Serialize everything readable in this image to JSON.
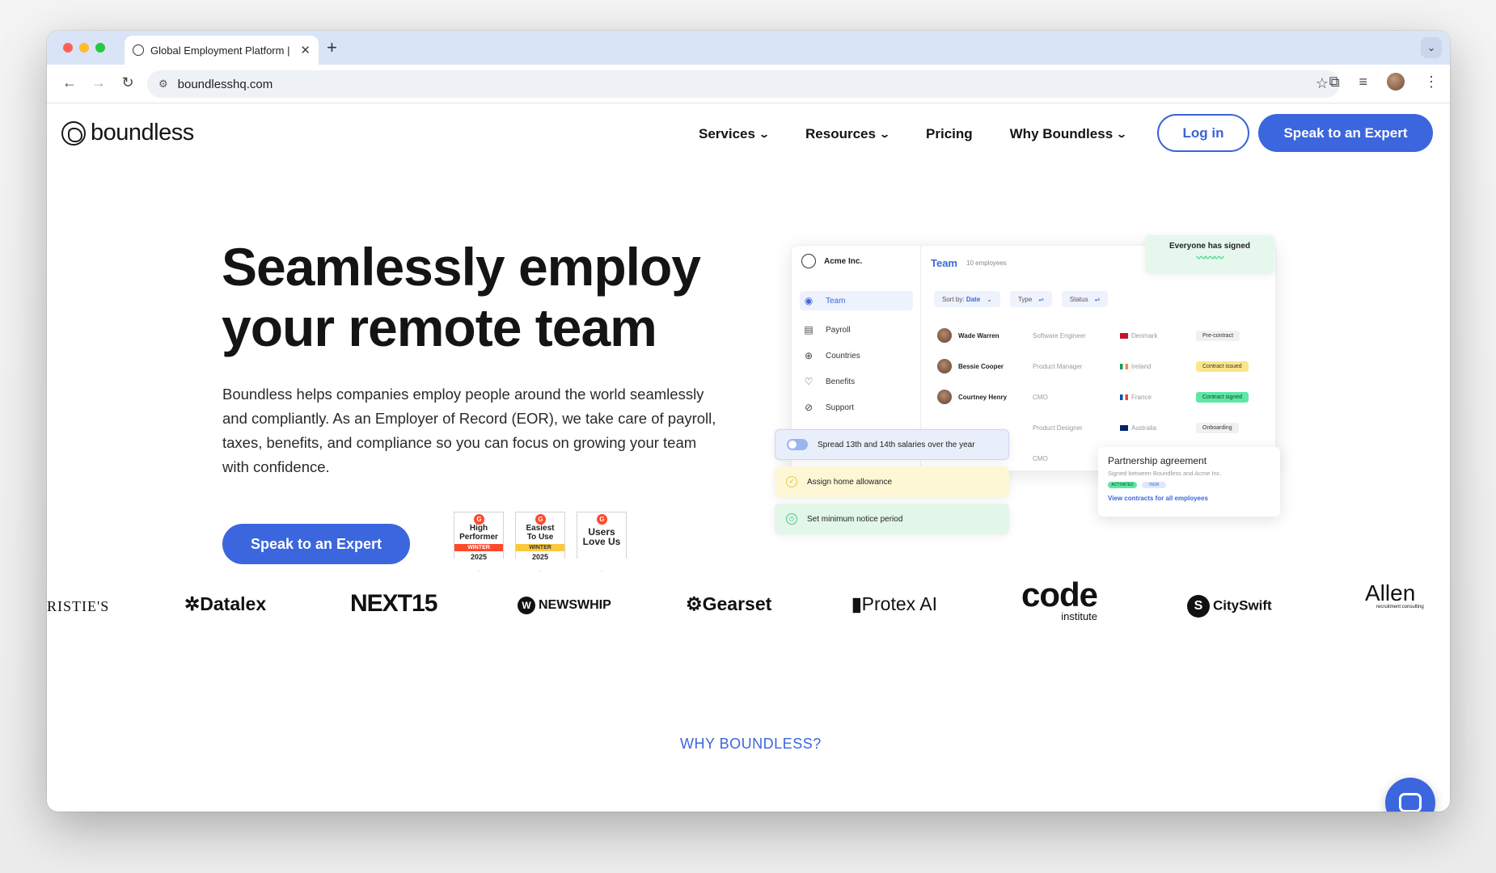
{
  "browser": {
    "tab_title": "Global Employment Platform |",
    "new_tab": "+",
    "url": "boundlesshq.com"
  },
  "site": {
    "logo_text": "boundless",
    "nav": [
      {
        "label": "Services"
      },
      {
        "label": "Resources"
      },
      {
        "label": "Pricing"
      },
      {
        "label": "Why Boundless"
      }
    ],
    "login_label": "Log in",
    "cta_top": "Speak to an Expert"
  },
  "hero": {
    "title": "Seamlessly employ your remote team",
    "description": "Boundless helps companies employ people around the world seamlessly and compliantly. As an Employer of Record (EOR), we take care of payroll, taxes, benefits, and compliance so you can focus on growing your team with confidence.",
    "cta": "Speak to an Expert",
    "badges": [
      {
        "line1": "High",
        "line2": "Performer",
        "season": "WINTER",
        "year": "2025"
      },
      {
        "line1": "Easiest",
        "line2": "To Use",
        "season": "WINTER",
        "year": "2025"
      },
      {
        "line1": "Users",
        "line2": "Love Us"
      }
    ]
  },
  "mockup": {
    "company": "Acme Inc.",
    "team_title": "Team",
    "team_count": "10 employees",
    "nav": [
      "Team",
      "Payroll",
      "Countries",
      "Benefits",
      "Support"
    ],
    "filters": {
      "sort_label": "Sort by:",
      "sort_value": "Date",
      "type": "Type",
      "status": "Status"
    },
    "signed": "Everyone has signed",
    "rows": [
      {
        "name": "Wade Warren",
        "role": "Software Engineer",
        "country": "Denmark",
        "status": "Pre-contract"
      },
      {
        "name": "Bessie Cooper",
        "role": "Product Manager",
        "country": "Ireland",
        "status": "Contract issued"
      },
      {
        "name": "Courtney Henry",
        "role": "CMO",
        "country": "France",
        "status": "Contract signed"
      },
      {
        "name": "",
        "role": "Product Designer",
        "country": "Australia",
        "status": "Onboarding"
      },
      {
        "name": "",
        "role": "CMO",
        "country": "",
        "status": ""
      }
    ],
    "cards": [
      "Spread 13th and 14th salaries over the year",
      "Assign home allowance",
      "Set minimum notice period"
    ],
    "partner": {
      "title": "Partnership agreement",
      "sub": "Signed between Boundless and Acme Inc.",
      "tag1": "ACTIVATED",
      "tag2": "VIEW",
      "link": "View contracts for all employees"
    }
  },
  "logos": [
    "RISTIE'S",
    "Datalex",
    "NEXT15",
    "NEWSWHIP",
    "Gearset",
    "Protex AI",
    "code",
    "institute",
    "CitySwift",
    "Allen",
    "recruitment consulting"
  ],
  "section_label": "WHY BOUNDLESS?",
  "colors": {
    "accent": "#3b66dd",
    "text": "#141414"
  }
}
